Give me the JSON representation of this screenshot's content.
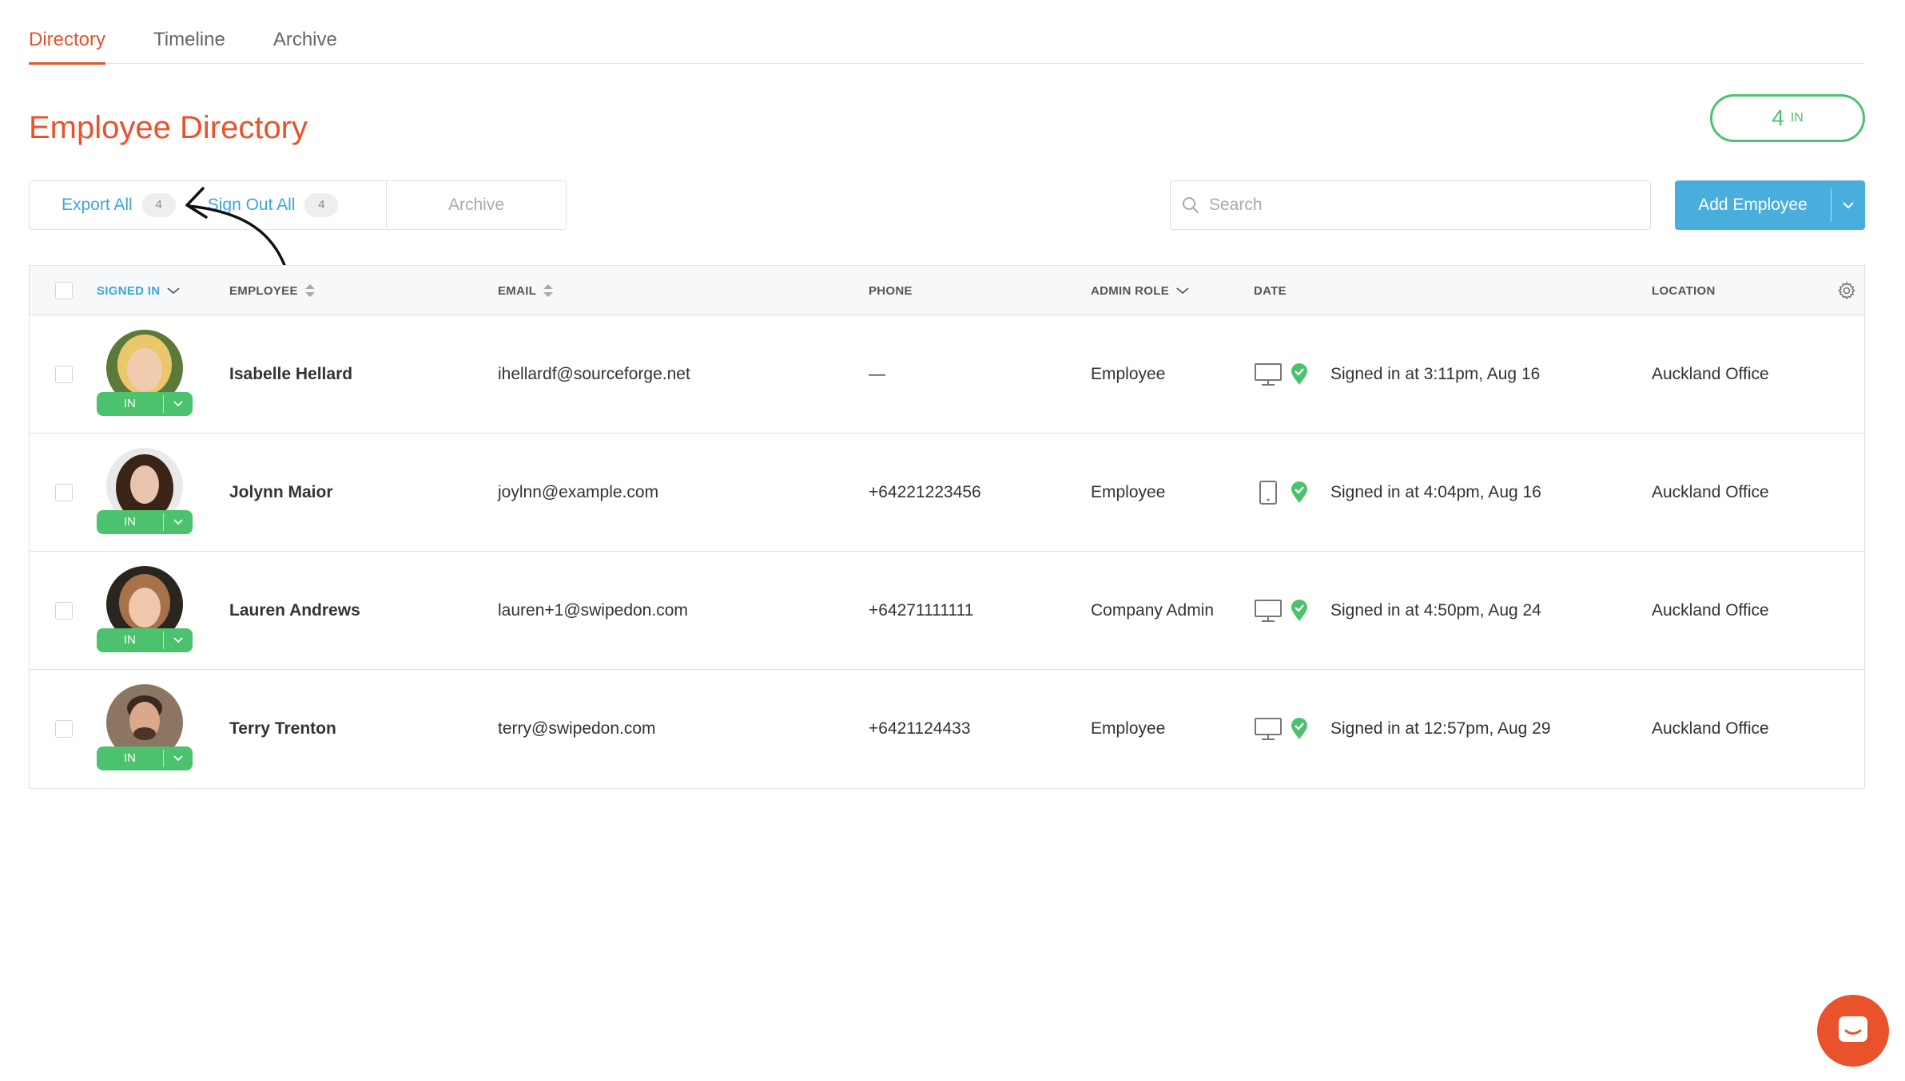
{
  "tabs": [
    {
      "label": "Directory",
      "active": true
    },
    {
      "label": "Timeline",
      "active": false
    },
    {
      "label": "Archive",
      "active": false
    }
  ],
  "page_title": "Employee Directory",
  "in_pill": {
    "count": "4",
    "label": "IN"
  },
  "actions": {
    "export_label": "Export All",
    "export_count": "4",
    "signout_label": "Sign Out All",
    "signout_count": "4",
    "archive_label": "Archive"
  },
  "search": {
    "placeholder": "Search",
    "value": ""
  },
  "add_button": {
    "label": "Add Employee"
  },
  "columns": {
    "signed_in": "SIGNED IN",
    "employee": "EMPLOYEE",
    "email": "EMAIL",
    "phone": "PHONE",
    "admin_role": "ADMIN ROLE",
    "date": "DATE",
    "location": "LOCATION"
  },
  "rows": [
    {
      "status": "IN",
      "name": "Isabelle Hellard",
      "email": "ihellardf@sourceforge.net",
      "phone": "—",
      "role": "Employee",
      "device": "desktop-icon",
      "date": "Signed in at 3:11pm, Aug 16",
      "location": "Auckland Office"
    },
    {
      "status": "IN",
      "name": "Jolynn Maior",
      "email": "joylnn@example.com",
      "phone": "+64221223456",
      "role": "Employee",
      "device": "tablet-icon",
      "date": "Signed in at 4:04pm, Aug 16",
      "location": "Auckland Office"
    },
    {
      "status": "IN",
      "name": "Lauren Andrews",
      "email": "lauren+1@swipedon.com",
      "phone": "+64271111111",
      "role": "Company Admin",
      "device": "desktop-icon",
      "date": "Signed in at 4:50pm, Aug 24",
      "location": "Auckland Office"
    },
    {
      "status": "IN",
      "name": "Terry Trenton",
      "email": "terry@swipedon.com",
      "phone": "+6421124433",
      "role": "Employee",
      "device": "desktop-icon",
      "date": "Signed in at 12:57pm, Aug 29",
      "location": "Auckland Office"
    }
  ],
  "colors": {
    "accent": "#e8532b",
    "primary": "#4aaedc",
    "success": "#4cc26e"
  }
}
